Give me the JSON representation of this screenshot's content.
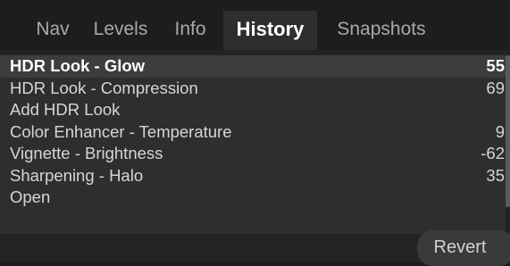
{
  "tabs": [
    {
      "label": "Nav",
      "active": false
    },
    {
      "label": "Levels",
      "active": false
    },
    {
      "label": "Info",
      "active": false
    },
    {
      "label": "History",
      "active": true
    },
    {
      "label": "Snapshots",
      "active": false
    }
  ],
  "history": {
    "items": [
      {
        "label": "HDR Look - Glow",
        "value": "55",
        "selected": true
      },
      {
        "label": "HDR Look - Compression",
        "value": "69",
        "selected": false
      },
      {
        "label": "Add HDR Look",
        "value": "",
        "selected": false
      },
      {
        "label": "Color Enhancer - Temperature",
        "value": "9",
        "selected": false
      },
      {
        "label": "Vignette - Brightness",
        "value": "-62",
        "selected": false
      },
      {
        "label": "Sharpening - Halo",
        "value": "35",
        "selected": false
      },
      {
        "label": "Open",
        "value": "",
        "selected": false
      }
    ]
  },
  "actions": {
    "revert_label": "Revert"
  },
  "colors": {
    "panel_bg": "#2e2e2e",
    "tabbar_bg": "#1d1d1d",
    "selected_row_bg": "#3d3d3d",
    "active_tab_text": "#ffffff",
    "inactive_tab_text": "#a9a9a9"
  }
}
